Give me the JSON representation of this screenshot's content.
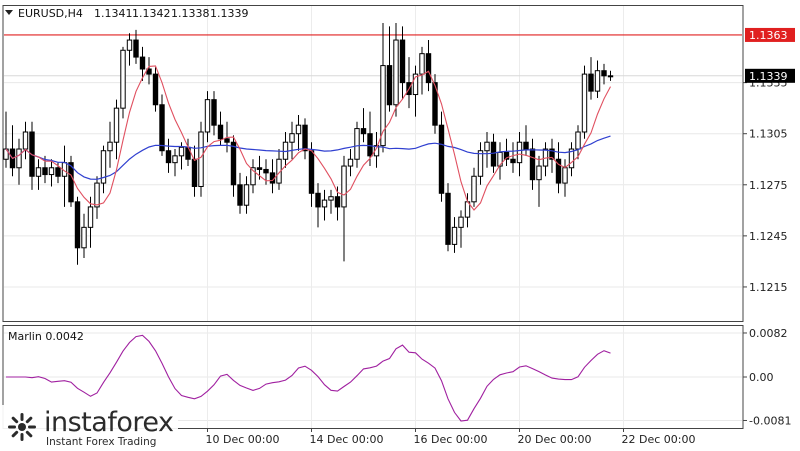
{
  "chart_data": [
    {
      "type": "candlestick",
      "title": "EURUSD,H4",
      "ohlc_header": [
        "1.1341",
        "1.1342",
        "1.1338",
        "1.1339"
      ],
      "ylim": [
        1.1195,
        1.138
      ],
      "y_ticks": [
        "1.1215",
        "1.1245",
        "1.1275",
        "1.1305",
        "1.1335"
      ],
      "reference_line": {
        "value": 1.1363,
        "label": "1.1363",
        "color": "#e02020"
      },
      "current_price": {
        "value": 1.1339,
        "label": "1.1339"
      },
      "x_labels": [
        "10 Dec 00:00",
        "14 Dec 00:00",
        "16 Dec 00:00",
        "20 Dec 00:00",
        "22 Dec 00:00"
      ],
      "x_label_index": [
        31,
        47,
        63,
        79,
        95
      ],
      "candles": [
        [
          1.129,
          1.1318,
          1.1285,
          1.1296
        ],
        [
          1.1296,
          1.131,
          1.128,
          1.1285
        ],
        [
          1.1285,
          1.1302,
          1.1275,
          1.1296
        ],
        [
          1.1296,
          1.1312,
          1.129,
          1.1306
        ],
        [
          1.1306,
          1.1312,
          1.1272,
          1.128
        ],
        [
          1.128,
          1.129,
          1.1272,
          1.1285
        ],
        [
          1.1285,
          1.1292,
          1.1276,
          1.1281
        ],
        [
          1.1281,
          1.129,
          1.1274,
          1.1285
        ],
        [
          1.1285,
          1.1288,
          1.1276,
          1.128
        ],
        [
          1.128,
          1.1298,
          1.1262,
          1.1288
        ],
        [
          1.1288,
          1.1292,
          1.1262,
          1.1265
        ],
        [
          1.1265,
          1.1268,
          1.1228,
          1.1238
        ],
        [
          1.1238,
          1.1258,
          1.1232,
          1.125
        ],
        [
          1.125,
          1.1268,
          1.1238,
          1.1262
        ],
        [
          1.1262,
          1.128,
          1.1255,
          1.1276
        ],
        [
          1.1276,
          1.1298,
          1.127,
          1.1295
        ],
        [
          1.1295,
          1.1312,
          1.1285,
          1.13
        ],
        [
          1.13,
          1.1325,
          1.129,
          1.132
        ],
        [
          1.132,
          1.1356,
          1.1314,
          1.1354
        ],
        [
          1.1354,
          1.1364,
          1.1345,
          1.136
        ],
        [
          1.136,
          1.1366,
          1.1346,
          1.135
        ],
        [
          1.135,
          1.1356,
          1.1336,
          1.1343
        ],
        [
          1.1343,
          1.135,
          1.1334,
          1.134
        ],
        [
          1.134,
          1.1344,
          1.1318,
          1.1322
        ],
        [
          1.1322,
          1.1328,
          1.1292,
          1.1295
        ],
        [
          1.1295,
          1.1302,
          1.1282,
          1.1288
        ],
        [
          1.1288,
          1.1296,
          1.128,
          1.1292
        ],
        [
          1.1292,
          1.13,
          1.1284,
          1.1297
        ],
        [
          1.1297,
          1.1302,
          1.1286,
          1.129
        ],
        [
          1.129,
          1.1298,
          1.1268,
          1.1274
        ],
        [
          1.1274,
          1.1312,
          1.1268,
          1.1306
        ],
        [
          1.1306,
          1.133,
          1.13,
          1.1325
        ],
        [
          1.1325,
          1.133,
          1.1304,
          1.131
        ],
        [
          1.131,
          1.1318,
          1.1298,
          1.1302
        ],
        [
          1.1302,
          1.1312,
          1.1294,
          1.13
        ],
        [
          1.13,
          1.1304,
          1.1268,
          1.1275
        ],
        [
          1.1275,
          1.1282,
          1.1258,
          1.1263
        ],
        [
          1.1263,
          1.128,
          1.1258,
          1.1275
        ],
        [
          1.1275,
          1.129,
          1.127,
          1.1285
        ],
        [
          1.1285,
          1.1292,
          1.1278,
          1.1284
        ],
        [
          1.1284,
          1.129,
          1.1275,
          1.1282
        ],
        [
          1.1282,
          1.129,
          1.127,
          1.1276
        ],
        [
          1.1276,
          1.1296,
          1.1272,
          1.129
        ],
        [
          1.129,
          1.1306,
          1.1285,
          1.13
        ],
        [
          1.13,
          1.1312,
          1.129,
          1.1305
        ],
        [
          1.1305,
          1.1316,
          1.1295,
          1.131
        ],
        [
          1.131,
          1.1314,
          1.129,
          1.1295
        ],
        [
          1.1295,
          1.13,
          1.1262,
          1.127
        ],
        [
          1.127,
          1.1276,
          1.125,
          1.1262
        ],
        [
          1.1262,
          1.1272,
          1.1254,
          1.1266
        ],
        [
          1.1266,
          1.1272,
          1.1258,
          1.1268
        ],
        [
          1.1268,
          1.1274,
          1.1254,
          1.1262
        ],
        [
          1.1262,
          1.1292,
          1.123,
          1.1286
        ],
        [
          1.1286,
          1.1296,
          1.128,
          1.129
        ],
        [
          1.129,
          1.1312,
          1.1285,
          1.1308
        ],
        [
          1.1308,
          1.132,
          1.13,
          1.1305
        ],
        [
          1.1305,
          1.1318,
          1.1286,
          1.1292
        ],
        [
          1.1292,
          1.1306,
          1.1285,
          1.1298
        ],
        [
          1.1298,
          1.137,
          1.1294,
          1.1345
        ],
        [
          1.1345,
          1.1368,
          1.1318,
          1.1322
        ],
        [
          1.1322,
          1.137,
          1.1315,
          1.136
        ],
        [
          1.136,
          1.1368,
          1.1325,
          1.1335
        ],
        [
          1.1335,
          1.135,
          1.132,
          1.1328
        ],
        [
          1.1328,
          1.1345,
          1.1315,
          1.134
        ],
        [
          1.134,
          1.1356,
          1.1328,
          1.1352
        ],
        [
          1.1352,
          1.136,
          1.133,
          1.1335
        ],
        [
          1.1335,
          1.134,
          1.1305,
          1.131
        ],
        [
          1.131,
          1.1318,
          1.1265,
          1.127
        ],
        [
          1.127,
          1.1276,
          1.1236,
          1.124
        ],
        [
          1.124,
          1.1256,
          1.1235,
          1.125
        ],
        [
          1.125,
          1.126,
          1.1238,
          1.1256
        ],
        [
          1.1256,
          1.127,
          1.125,
          1.1265
        ],
        [
          1.1265,
          1.1285,
          1.1262,
          1.128
        ],
        [
          1.128,
          1.13,
          1.1275,
          1.1295
        ],
        [
          1.1295,
          1.1306,
          1.1285,
          1.13
        ],
        [
          1.13,
          1.1305,
          1.1282,
          1.1286
        ],
        [
          1.1286,
          1.13,
          1.1278,
          1.1294
        ],
        [
          1.1294,
          1.1302,
          1.1286,
          1.129
        ],
        [
          1.129,
          1.13,
          1.1282,
          1.1288
        ],
        [
          1.1288,
          1.1306,
          1.128,
          1.13
        ],
        [
          1.13,
          1.131,
          1.1292,
          1.1296
        ],
        [
          1.1296,
          1.1302,
          1.1272,
          1.1278
        ],
        [
          1.1278,
          1.1292,
          1.1262,
          1.1286
        ],
        [
          1.1286,
          1.13,
          1.128,
          1.1296
        ],
        [
          1.1296,
          1.1302,
          1.1282,
          1.129
        ],
        [
          1.129,
          1.13,
          1.127,
          1.1276
        ],
        [
          1.1276,
          1.129,
          1.1268,
          1.1285
        ],
        [
          1.1285,
          1.13,
          1.128,
          1.1296
        ],
        [
          1.1296,
          1.131,
          1.129,
          1.1306
        ],
        [
          1.1306,
          1.1345,
          1.1302,
          1.134
        ],
        [
          1.134,
          1.135,
          1.1325,
          1.133
        ],
        [
          1.133,
          1.1348,
          1.1326,
          1.1342
        ],
        [
          1.1342,
          1.1346,
          1.1334,
          1.1339
        ],
        [
          1.1339,
          1.1342,
          1.1336,
          1.1339
        ]
      ],
      "sub_chart": {
        "title": "Marlin 0.0042",
        "ylim": [
          -0.0095,
          0.0095
        ],
        "y_ticks": [
          "0.0082",
          "0.00",
          "-0.0081"
        ],
        "y_tick_values": [
          0.0082,
          0.0,
          -0.0081
        ],
        "color": "#a020a0"
      }
    }
  ],
  "watermark": {
    "brand": "instaforex",
    "tagline": "Instant Forex Trading"
  }
}
